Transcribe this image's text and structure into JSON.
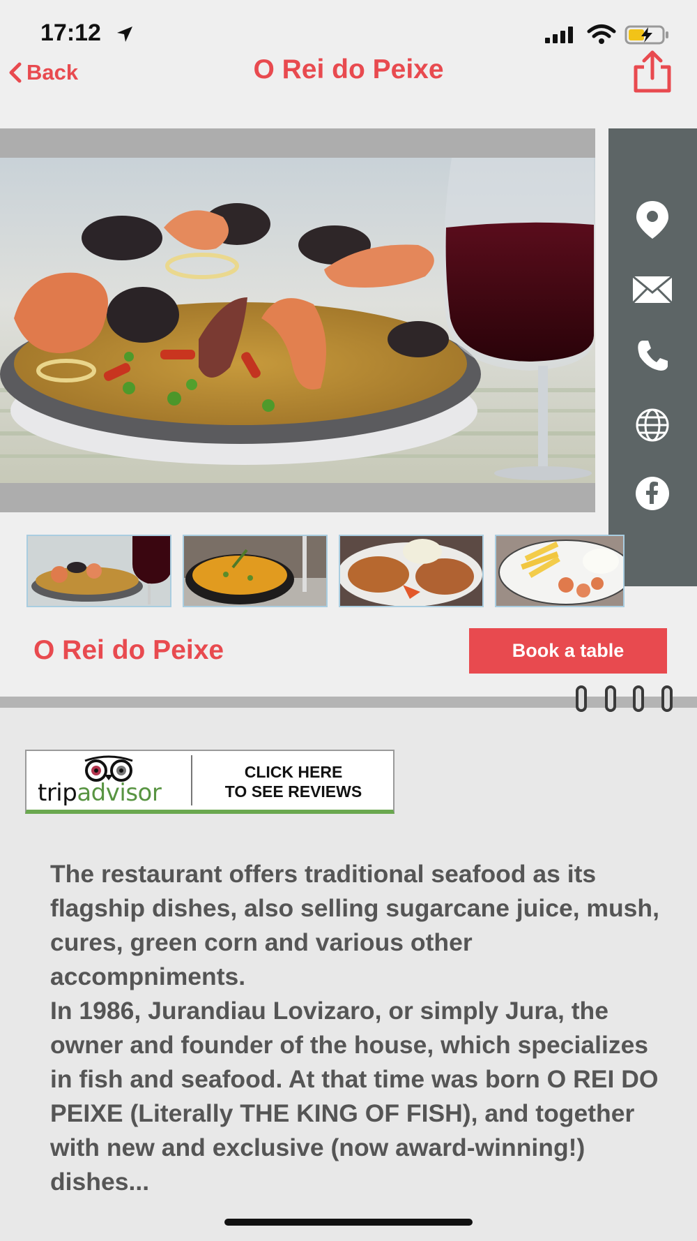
{
  "status_bar": {
    "time": "17:12"
  },
  "nav": {
    "back_label": "Back",
    "title": "O Rei do Peixe"
  },
  "gallery": {
    "main_photo": "paella-seafood-wine",
    "thumbnails": [
      "paella-seafood",
      "fish-stew-pot",
      "grilled-crab",
      "fries-shrimp-plate"
    ]
  },
  "side_actions": [
    {
      "icon": "location-pin-icon"
    },
    {
      "icon": "mail-icon"
    },
    {
      "icon": "phone-icon"
    },
    {
      "icon": "globe-icon"
    },
    {
      "icon": "facebook-icon"
    }
  ],
  "restaurant": {
    "name": "O Rei do Peixe",
    "book_label": "Book a table"
  },
  "tripadvisor": {
    "brand_trip": "trip",
    "brand_advisor": "advisor",
    "cta_line1": "CLICK HERE",
    "cta_line2": "TO SEE REVIEWS"
  },
  "description": {
    "paragraph1": "The restaurant offers traditional seafood as its flagship dishes, also selling sugarcane juice, mush, cures, green corn and various other accompniments.",
    "paragraph2": "In 1986, Jurandiau Lovizaro, or simply Jura, the owner and founder of the house, which specializes in fish and seafood. At that time was born O REI DO PEIXE (Literally THE KING OF FISH), and together with new and exclusive (now award-winning!) dishes..."
  },
  "colors": {
    "accent": "#e84a4f",
    "side_panel": "#5d6566",
    "text": "#555555"
  }
}
